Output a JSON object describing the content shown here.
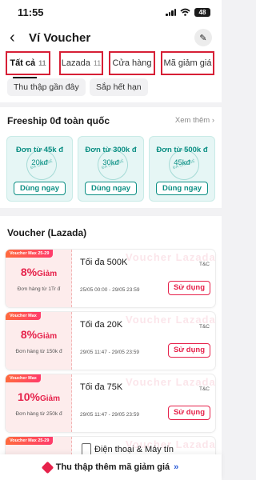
{
  "status_bar": {
    "time": "11:55",
    "battery": "48"
  },
  "header": {
    "title": "Ví Voucher"
  },
  "tabs": [
    {
      "label": "Tất cả",
      "count": "11"
    },
    {
      "label": "Lazada",
      "count": "11"
    },
    {
      "label": "Cửa hàng",
      "count": ""
    },
    {
      "label": "Mã giảm giá",
      "count": ""
    }
  ],
  "filters": [
    "Thu thập gần đây",
    "Sắp hết hạn"
  ],
  "freeship": {
    "title": "Freeship 0đ toàn quốc",
    "see_more": "Xem thêm ›",
    "stamp": "ĐÃ CHIA SẺ",
    "cards": [
      {
        "condition": "Đơn từ 45k đ",
        "value": "20kđ",
        "button": "Dùng ngay"
      },
      {
        "condition": "Đơn từ 300k đ",
        "value": "30kđ",
        "button": "Dùng ngay"
      },
      {
        "condition": "Đơn từ 500k đ",
        "value": "45kđ",
        "button": "Dùng ngay"
      }
    ]
  },
  "voucher_section": {
    "title": "Voucher (Lazada)",
    "watermark": "Voucher Lazada",
    "vouchers": [
      {
        "tag": "Voucher Max 25-29",
        "discount": "8%",
        "word": "Giảm",
        "min_order": "Đơn hàng từ 1Tr đ",
        "title": "Tối đa 500K",
        "date": "25/05 00:00 - 29/05 23:59",
        "tc": "T&C",
        "button": "Sử dụng"
      },
      {
        "tag": "Voucher Max",
        "discount": "8%",
        "word": "Giảm",
        "min_order": "Đơn hàng từ 150k đ",
        "title": "Tối đa 20K",
        "date": "29/05 11:47 - 29/05 23:59",
        "tc": "T&C",
        "button": "Sử dụng"
      },
      {
        "tag": "Voucher Max",
        "discount": "10%",
        "word": "Giảm",
        "min_order": "Đơn hàng từ 250k đ",
        "title": "Tối đa 75K",
        "date": "29/05 11:47 - 29/05 23:59",
        "tc": "T&C",
        "button": "Sử dụng"
      },
      {
        "tag": "Voucher Max 25-29",
        "title": "Điện thoại & Máy tín"
      }
    ]
  },
  "bottom_bar": {
    "label": "Thu thập thêm mã giảm giá",
    "chevron": "»"
  },
  "colors": {
    "accent": "#e6224b",
    "teal": "#0c8f84",
    "highlight_box": "#d71f36"
  }
}
